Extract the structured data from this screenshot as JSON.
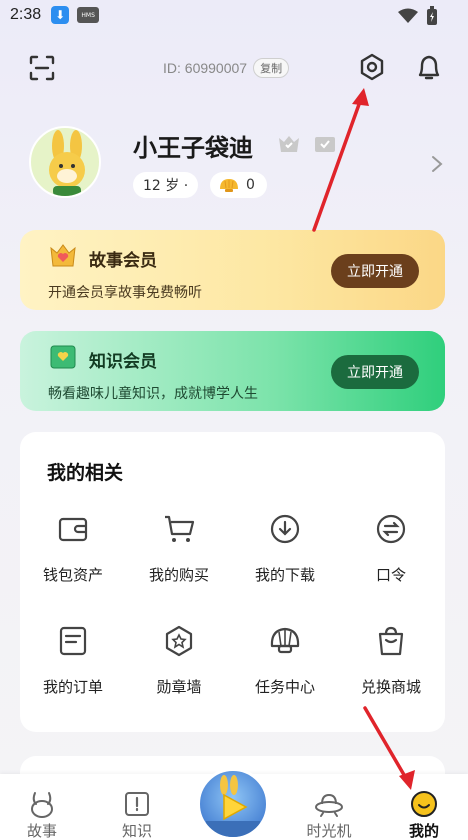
{
  "status_bar": {
    "time": "2:38",
    "hms_label": "HMS"
  },
  "header": {
    "user_id": "ID: 60990007",
    "copy_label": "复制"
  },
  "profile": {
    "username": "小王子袋迪",
    "age": "12 岁 ·",
    "coins": "0"
  },
  "vip_cards": [
    {
      "title": "故事会员",
      "desc": "开通会员享故事免费畅听",
      "button": "立即开通"
    },
    {
      "title": "知识会员",
      "desc": "畅看趣味儿童知识，成就博学人生",
      "button": "立即开通"
    }
  ],
  "related": {
    "title": "我的相关",
    "items": [
      {
        "label": "钱包资产",
        "icon": "wallet-icon"
      },
      {
        "label": "我的购买",
        "icon": "cart-icon"
      },
      {
        "label": "我的下载",
        "icon": "download-icon"
      },
      {
        "label": "口令",
        "icon": "exchange-icon"
      },
      {
        "label": "我的订单",
        "icon": "order-icon"
      },
      {
        "label": "勋章墙",
        "icon": "medal-icon"
      },
      {
        "label": "任务中心",
        "icon": "shell-icon"
      },
      {
        "label": "兑换商城",
        "icon": "shopping-bag-icon"
      }
    ]
  },
  "tabbar": {
    "items": [
      {
        "label": "故事",
        "icon": "bunny-icon"
      },
      {
        "label": "知识",
        "icon": "book-icon"
      },
      {
        "label": "时光机",
        "icon": "ufo-icon"
      },
      {
        "label": "我的",
        "icon": "smile-icon",
        "active": true
      }
    ]
  },
  "colors": {
    "annotation_arrow": "#e0242b",
    "story_button": "#6b3f1c",
    "knowledge_button": "#1b6b3e"
  }
}
